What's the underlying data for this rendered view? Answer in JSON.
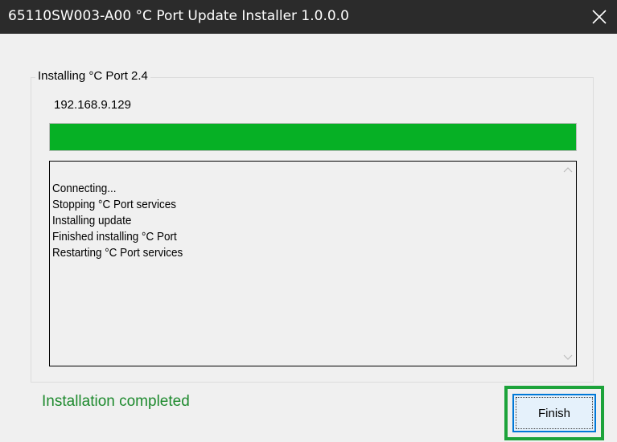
{
  "window": {
    "title": "65110SW003-A00 °C Port Update Installer 1.0.0.0",
    "close_icon": "close-icon"
  },
  "group": {
    "legend": "Installing °C Port 2.4",
    "ip_address": "192.168.9.129"
  },
  "progress": {
    "value_percent": 100,
    "color": "#06b025"
  },
  "log": {
    "lines": [
      "Connecting...",
      "Stopping °C Port services",
      "Installing update",
      "Finished installing °C Port",
      "Restarting °C Port services"
    ],
    "scroll_up_icon": "chevron-up-icon",
    "scroll_down_icon": "chevron-down-icon"
  },
  "status": {
    "text": "Installation completed",
    "color": "#1e8a2e"
  },
  "buttons": {
    "finish_label": "Finish",
    "highlight_color": "#1ca33a"
  }
}
